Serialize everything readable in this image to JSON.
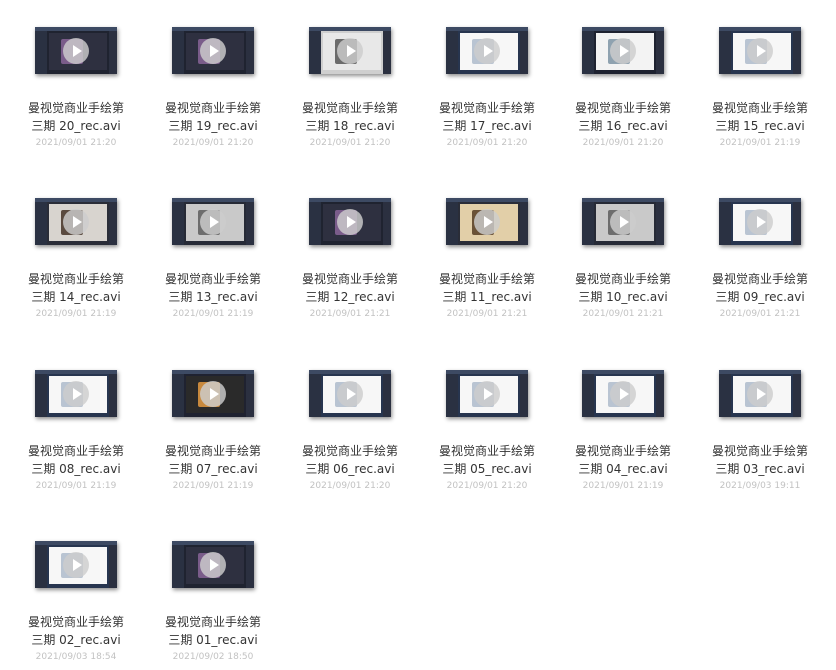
{
  "files": [
    {
      "line1": "曼视觉商业手绘第",
      "line2": "三期 20_rec.avi",
      "date": "2021/09/01 21:20",
      "theme": "dark"
    },
    {
      "line1": "曼视觉商业手绘第",
      "line2": "三期 19_rec.avi",
      "date": "2021/09/01 21:20",
      "theme": "dark"
    },
    {
      "line1": "曼视觉商业手绘第",
      "line2": "三期 18_rec.avi",
      "date": "2021/09/01 21:20",
      "theme": "portrait"
    },
    {
      "line1": "曼视觉商业手绘第",
      "line2": "三期 17_rec.avi",
      "date": "2021/09/01 21:20",
      "theme": "light"
    },
    {
      "line1": "曼视觉商业手绘第",
      "line2": "三期 16_rec.avi",
      "date": "2021/09/01 21:20",
      "theme": "portrait-light"
    },
    {
      "line1": "曼视觉商业手绘第",
      "line2": "三期 15_rec.avi",
      "date": "2021/09/01 21:19",
      "theme": "light"
    },
    {
      "line1": "曼视觉商业手绘第",
      "line2": "三期 14_rec.avi",
      "date": "2021/09/01 21:19",
      "theme": "gallery"
    },
    {
      "line1": "曼视觉商业手绘第",
      "line2": "三期 13_rec.avi",
      "date": "2021/09/01 21:19",
      "theme": "gray"
    },
    {
      "line1": "曼视觉商业手绘第",
      "line2": "三期 12_rec.avi",
      "date": "2021/09/01 21:21",
      "theme": "dark"
    },
    {
      "line1": "曼视觉商业手绘第",
      "line2": "三期 11_rec.avi",
      "date": "2021/09/01 21:21",
      "theme": "sepia"
    },
    {
      "line1": "曼视觉商业手绘第",
      "line2": "三期 10_rec.avi",
      "date": "2021/09/01 21:21",
      "theme": "gray"
    },
    {
      "line1": "曼视觉商业手绘第",
      "line2": "三期 09_rec.avi",
      "date": "2021/09/01 21:21",
      "theme": "light"
    },
    {
      "line1": "曼视觉商业手绘第",
      "line2": "三期 08_rec.avi",
      "date": "2021/09/01 21:19",
      "theme": "light"
    },
    {
      "line1": "曼视觉商业手绘第",
      "line2": "三期 07_rec.avi",
      "date": "2021/09/01 21:19",
      "theme": "warm"
    },
    {
      "line1": "曼视觉商业手绘第",
      "line2": "三期 06_rec.avi",
      "date": "2021/09/01 21:20",
      "theme": "light"
    },
    {
      "line1": "曼视觉商业手绘第",
      "line2": "三期 05_rec.avi",
      "date": "2021/09/01 21:20",
      "theme": "light"
    },
    {
      "line1": "曼视觉商业手绘第",
      "line2": "三期 04_rec.avi",
      "date": "2021/09/01 21:19",
      "theme": "light"
    },
    {
      "line1": "曼视觉商业手绘第",
      "line2": "三期 03_rec.avi",
      "date": "2021/09/03 19:11",
      "theme": "light"
    },
    {
      "line1": "曼视觉商业手绘第",
      "line2": "三期 02_rec.avi",
      "date": "2021/09/03 18:54",
      "theme": "light"
    },
    {
      "line1": "曼视觉商业手绘第",
      "line2": "三期 01_rec.avi",
      "date": "2021/09/02 18:50",
      "theme": "dark"
    }
  ],
  "colors": {
    "name_text": "#333333",
    "date_text": "#c2c2c2",
    "background": "#ffffff"
  },
  "icons": {
    "thumbnail_overlay": "play-icon"
  }
}
